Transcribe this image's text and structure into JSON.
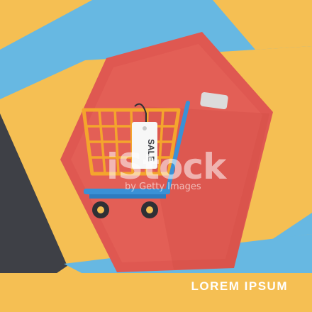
{
  "illustration": {
    "sale_tag_label": "SALE",
    "footer_label": "LOREM IPSUM"
  },
  "watermark": {
    "main": "iStock",
    "sub": "by Getty Images"
  },
  "colors": {
    "sky_blue": "#67b8e2",
    "yellow": "#f5bf53",
    "charcoal": "#3e4046",
    "hexagon_red": "#df5851",
    "hexagon_inner": "#ea6d62",
    "cart_orange": "#f4a52d",
    "cart_blue": "#3a91d6",
    "handle_gray": "#dcdcdc",
    "wheel_dark": "#2f3035",
    "tag_white": "#f7f7f7",
    "text_white": "#ffffff"
  },
  "icons": [
    "shopping-cart-icon",
    "sale-tag-icon"
  ]
}
